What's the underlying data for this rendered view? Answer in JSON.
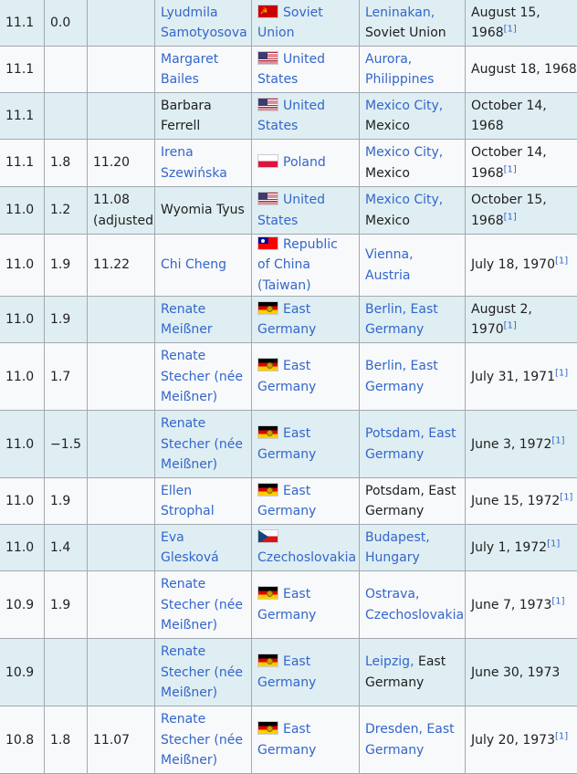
{
  "rows": [
    {
      "time": "11.1",
      "wind": "0.0",
      "auto": "",
      "athlete": "Lyudmila Samotyosova",
      "athlete_link": true,
      "flag": "soviet",
      "nation": "Soviet Union",
      "venue_link": "Leninakan,",
      "venue_rest": " Soviet Union",
      "date": "August 15, 1968",
      "ref": "[1]"
    },
    {
      "time": "11.1",
      "wind": "",
      "auto": "",
      "athlete": "Margaret Bailes",
      "athlete_link": true,
      "flag": "us",
      "nation": "United States",
      "venue_link": "Aurora, Philippines",
      "venue_rest": "",
      "date": "August 18, 1968",
      "ref": ""
    },
    {
      "time": "11.1",
      "wind": "",
      "auto": "",
      "athlete": "Barbara Ferrell",
      "athlete_link": false,
      "flag": "us",
      "nation": "United States",
      "venue_link": "Mexico City,",
      "venue_rest": " Mexico",
      "date": "October 14, 1968",
      "ref": ""
    },
    {
      "time": "11.1",
      "wind": "1.8",
      "auto": "11.20",
      "athlete": "Irena Szewińska",
      "athlete_link": true,
      "flag": "pl",
      "nation": "Poland",
      "venue_link": "Mexico City,",
      "venue_rest": " Mexico",
      "date": "October 14, 1968",
      "ref": "[1]"
    },
    {
      "time": "11.0",
      "wind": "1.2",
      "auto": "11.08 (adjusted)",
      "athlete": "Wyomia Tyus",
      "athlete_link": false,
      "flag": "us",
      "nation": "United States",
      "venue_link": "Mexico City,",
      "venue_rest": " Mexico",
      "date": "October 15, 1968",
      "ref": "[1]"
    },
    {
      "time": "11.0",
      "wind": "1.9",
      "auto": "11.22",
      "athlete": "Chi Cheng",
      "athlete_link": true,
      "flag": "roc",
      "nation": "Republic of China (Taiwan)",
      "venue_link": "Vienna, Austria",
      "venue_rest": "",
      "date": "July 18, 1970",
      "ref": "[1]"
    },
    {
      "time": "11.0",
      "wind": "1.9",
      "auto": "",
      "athlete": "Renate Meißner",
      "athlete_link": true,
      "flag": "gdr",
      "nation": "East Germany",
      "venue_link": "Berlin, East Germany",
      "venue_rest": "",
      "date": "August 2, 1970",
      "ref": "[1]"
    },
    {
      "time": "11.0",
      "wind": "1.7",
      "auto": "",
      "athlete": "Renate Stecher (née Meißner)",
      "athlete_link": true,
      "flag": "gdr",
      "nation": "East Germany",
      "venue_link": "Berlin, East Germany",
      "venue_rest": "",
      "date": "July 31, 1971",
      "ref": "[1]"
    },
    {
      "time": "11.0",
      "wind": "−1.5",
      "auto": "",
      "athlete": "Renate Stecher (née Meißner)",
      "athlete_link": true,
      "flag": "gdr",
      "nation": "East Germany",
      "venue_link": "Potsdam, East Germany",
      "venue_rest": "",
      "date": "June 3, 1972",
      "ref": "[1]"
    },
    {
      "time": "11.0",
      "wind": "1.9",
      "auto": "",
      "athlete": "Ellen Strophal",
      "athlete_link": true,
      "flag": "gdr",
      "nation": "East Germany",
      "venue_link": "",
      "venue_rest": "Potsdam, East Germany",
      "date": "June 15, 1972",
      "ref": "[1]"
    },
    {
      "time": "11.0",
      "wind": "1.4",
      "auto": "",
      "athlete": "Eva Glesková",
      "athlete_link": true,
      "flag": "cs",
      "nation": "Czechoslovakia",
      "venue_link": "Budapest, Hungary",
      "venue_rest": "",
      "date": "July 1, 1972",
      "ref": "[1]"
    },
    {
      "time": "10.9",
      "wind": "1.9",
      "auto": "",
      "athlete": "Renate Stecher (née Meißner)",
      "athlete_link": true,
      "flag": "gdr",
      "nation": "East Germany",
      "venue_link": "Ostrava, Czechoslovakia",
      "venue_rest": "",
      "date": "June 7, 1973",
      "ref": "[1]"
    },
    {
      "time": "10.9",
      "wind": "",
      "auto": "",
      "athlete": "Renate Stecher (née Meißner)",
      "athlete_link": true,
      "flag": "gdr",
      "nation": "East Germany",
      "venue_link": "Leipzig,",
      "venue_rest": " East Germany",
      "date": "June 30, 1973",
      "ref": ""
    },
    {
      "time": "10.8",
      "wind": "1.8",
      "auto": "11.07",
      "athlete": "Renate Stecher (née Meißner)",
      "athlete_link": true,
      "flag": "gdr",
      "nation": "East Germany",
      "venue_link": "Dresden, East Germany",
      "venue_rest": "",
      "date": "July 20, 1973",
      "ref": "[1]"
    }
  ]
}
